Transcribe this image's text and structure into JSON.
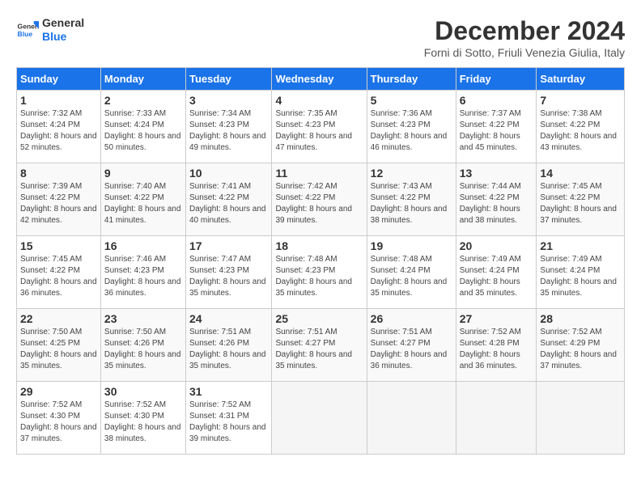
{
  "logo": {
    "line1": "General",
    "line2": "Blue"
  },
  "title": "December 2024",
  "subtitle": "Forni di Sotto, Friuli Venezia Giulia, Italy",
  "header_days": [
    "Sunday",
    "Monday",
    "Tuesday",
    "Wednesday",
    "Thursday",
    "Friday",
    "Saturday"
  ],
  "weeks": [
    [
      {
        "day": "1",
        "sunrise": "Sunrise: 7:32 AM",
        "sunset": "Sunset: 4:24 PM",
        "daylight": "Daylight: 8 hours and 52 minutes."
      },
      {
        "day": "2",
        "sunrise": "Sunrise: 7:33 AM",
        "sunset": "Sunset: 4:24 PM",
        "daylight": "Daylight: 8 hours and 50 minutes."
      },
      {
        "day": "3",
        "sunrise": "Sunrise: 7:34 AM",
        "sunset": "Sunset: 4:23 PM",
        "daylight": "Daylight: 8 hours and 49 minutes."
      },
      {
        "day": "4",
        "sunrise": "Sunrise: 7:35 AM",
        "sunset": "Sunset: 4:23 PM",
        "daylight": "Daylight: 8 hours and 47 minutes."
      },
      {
        "day": "5",
        "sunrise": "Sunrise: 7:36 AM",
        "sunset": "Sunset: 4:23 PM",
        "daylight": "Daylight: 8 hours and 46 minutes."
      },
      {
        "day": "6",
        "sunrise": "Sunrise: 7:37 AM",
        "sunset": "Sunset: 4:22 PM",
        "daylight": "Daylight: 8 hours and 45 minutes."
      },
      {
        "day": "7",
        "sunrise": "Sunrise: 7:38 AM",
        "sunset": "Sunset: 4:22 PM",
        "daylight": "Daylight: 8 hours and 43 minutes."
      }
    ],
    [
      {
        "day": "8",
        "sunrise": "Sunrise: 7:39 AM",
        "sunset": "Sunset: 4:22 PM",
        "daylight": "Daylight: 8 hours and 42 minutes."
      },
      {
        "day": "9",
        "sunrise": "Sunrise: 7:40 AM",
        "sunset": "Sunset: 4:22 PM",
        "daylight": "Daylight: 8 hours and 41 minutes."
      },
      {
        "day": "10",
        "sunrise": "Sunrise: 7:41 AM",
        "sunset": "Sunset: 4:22 PM",
        "daylight": "Daylight: 8 hours and 40 minutes."
      },
      {
        "day": "11",
        "sunrise": "Sunrise: 7:42 AM",
        "sunset": "Sunset: 4:22 PM",
        "daylight": "Daylight: 8 hours and 39 minutes."
      },
      {
        "day": "12",
        "sunrise": "Sunrise: 7:43 AM",
        "sunset": "Sunset: 4:22 PM",
        "daylight": "Daylight: 8 hours and 38 minutes."
      },
      {
        "day": "13",
        "sunrise": "Sunrise: 7:44 AM",
        "sunset": "Sunset: 4:22 PM",
        "daylight": "Daylight: 8 hours and 38 minutes."
      },
      {
        "day": "14",
        "sunrise": "Sunrise: 7:45 AM",
        "sunset": "Sunset: 4:22 PM",
        "daylight": "Daylight: 8 hours and 37 minutes."
      }
    ],
    [
      {
        "day": "15",
        "sunrise": "Sunrise: 7:45 AM",
        "sunset": "Sunset: 4:22 PM",
        "daylight": "Daylight: 8 hours and 36 minutes."
      },
      {
        "day": "16",
        "sunrise": "Sunrise: 7:46 AM",
        "sunset": "Sunset: 4:23 PM",
        "daylight": "Daylight: 8 hours and 36 minutes."
      },
      {
        "day": "17",
        "sunrise": "Sunrise: 7:47 AM",
        "sunset": "Sunset: 4:23 PM",
        "daylight": "Daylight: 8 hours and 35 minutes."
      },
      {
        "day": "18",
        "sunrise": "Sunrise: 7:48 AM",
        "sunset": "Sunset: 4:23 PM",
        "daylight": "Daylight: 8 hours and 35 minutes."
      },
      {
        "day": "19",
        "sunrise": "Sunrise: 7:48 AM",
        "sunset": "Sunset: 4:24 PM",
        "daylight": "Daylight: 8 hours and 35 minutes."
      },
      {
        "day": "20",
        "sunrise": "Sunrise: 7:49 AM",
        "sunset": "Sunset: 4:24 PM",
        "daylight": "Daylight: 8 hours and 35 minutes."
      },
      {
        "day": "21",
        "sunrise": "Sunrise: 7:49 AM",
        "sunset": "Sunset: 4:24 PM",
        "daylight": "Daylight: 8 hours and 35 minutes."
      }
    ],
    [
      {
        "day": "22",
        "sunrise": "Sunrise: 7:50 AM",
        "sunset": "Sunset: 4:25 PM",
        "daylight": "Daylight: 8 hours and 35 minutes."
      },
      {
        "day": "23",
        "sunrise": "Sunrise: 7:50 AM",
        "sunset": "Sunset: 4:26 PM",
        "daylight": "Daylight: 8 hours and 35 minutes."
      },
      {
        "day": "24",
        "sunrise": "Sunrise: 7:51 AM",
        "sunset": "Sunset: 4:26 PM",
        "daylight": "Daylight: 8 hours and 35 minutes."
      },
      {
        "day": "25",
        "sunrise": "Sunrise: 7:51 AM",
        "sunset": "Sunset: 4:27 PM",
        "daylight": "Daylight: 8 hours and 35 minutes."
      },
      {
        "day": "26",
        "sunrise": "Sunrise: 7:51 AM",
        "sunset": "Sunset: 4:27 PM",
        "daylight": "Daylight: 8 hours and 36 minutes."
      },
      {
        "day": "27",
        "sunrise": "Sunrise: 7:52 AM",
        "sunset": "Sunset: 4:28 PM",
        "daylight": "Daylight: 8 hours and 36 minutes."
      },
      {
        "day": "28",
        "sunrise": "Sunrise: 7:52 AM",
        "sunset": "Sunset: 4:29 PM",
        "daylight": "Daylight: 8 hours and 37 minutes."
      }
    ],
    [
      {
        "day": "29",
        "sunrise": "Sunrise: 7:52 AM",
        "sunset": "Sunset: 4:30 PM",
        "daylight": "Daylight: 8 hours and 37 minutes."
      },
      {
        "day": "30",
        "sunrise": "Sunrise: 7:52 AM",
        "sunset": "Sunset: 4:30 PM",
        "daylight": "Daylight: 8 hours and 38 minutes."
      },
      {
        "day": "31",
        "sunrise": "Sunrise: 7:52 AM",
        "sunset": "Sunset: 4:31 PM",
        "daylight": "Daylight: 8 hours and 39 minutes."
      },
      null,
      null,
      null,
      null
    ]
  ]
}
